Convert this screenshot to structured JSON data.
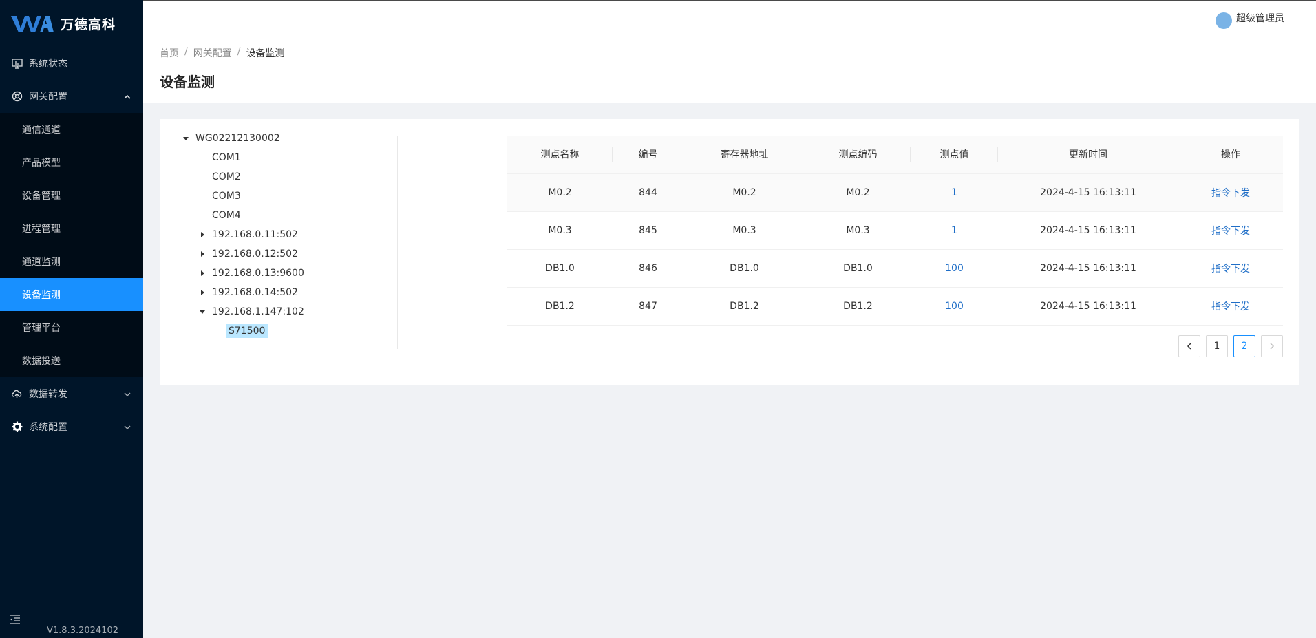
{
  "brand": {
    "name": "万德高科"
  },
  "sidebar": {
    "items": [
      {
        "label": "系统状态",
        "icon": "monitor-icon"
      },
      {
        "label": "网关配置",
        "icon": "gateway-icon",
        "expanded": true,
        "children": [
          {
            "label": "通信通道"
          },
          {
            "label": "产品模型"
          },
          {
            "label": "设备管理"
          },
          {
            "label": "进程管理"
          },
          {
            "label": "通道监测"
          },
          {
            "label": "设备监测",
            "active": true
          },
          {
            "label": "管理平台"
          },
          {
            "label": "数据投送"
          }
        ]
      },
      {
        "label": "数据转发",
        "icon": "cloud-upload-icon"
      },
      {
        "label": "系统配置",
        "icon": "gear-icon"
      }
    ],
    "version": "V1.8.3.2024102"
  },
  "header": {
    "user": "超级管理员"
  },
  "breadcrumb": {
    "items": [
      "首页",
      "网关配置",
      "设备监测"
    ]
  },
  "page_title": "设备监测",
  "tree": {
    "root": "WG02212130002",
    "nodes": [
      "COM1",
      "COM2",
      "COM3",
      "COM4",
      "192.168.0.11:502",
      "192.168.0.12:502",
      "192.168.0.13:9600",
      "192.168.0.14:502",
      "192.168.1.147:102"
    ],
    "leaf": "S71500"
  },
  "table": {
    "columns": [
      "测点名称",
      "编号",
      "寄存器地址",
      "测点编码",
      "测点值",
      "更新时间",
      "操作"
    ],
    "rows": [
      [
        "M0.2",
        "844",
        "M0.2",
        "M0.2",
        "1",
        "2024-4-15 16:13:11",
        "指令下发"
      ],
      [
        "M0.3",
        "845",
        "M0.3",
        "M0.3",
        "1",
        "2024-4-15 16:13:11",
        "指令下发"
      ],
      [
        "DB1.0",
        "846",
        "DB1.0",
        "DB1.0",
        "100",
        "2024-4-15 16:13:11",
        "指令下发"
      ],
      [
        "DB1.2",
        "847",
        "DB1.2",
        "DB1.2",
        "100",
        "2024-4-15 16:13:11",
        "指令下发"
      ]
    ]
  },
  "pagination": {
    "pages": [
      "1",
      "2"
    ],
    "current": "2"
  },
  "colors": {
    "sidebar_bg": "#001529",
    "submenu_bg": "#000c17",
    "accent": "#1890ff",
    "link": "#1f6ec7"
  }
}
